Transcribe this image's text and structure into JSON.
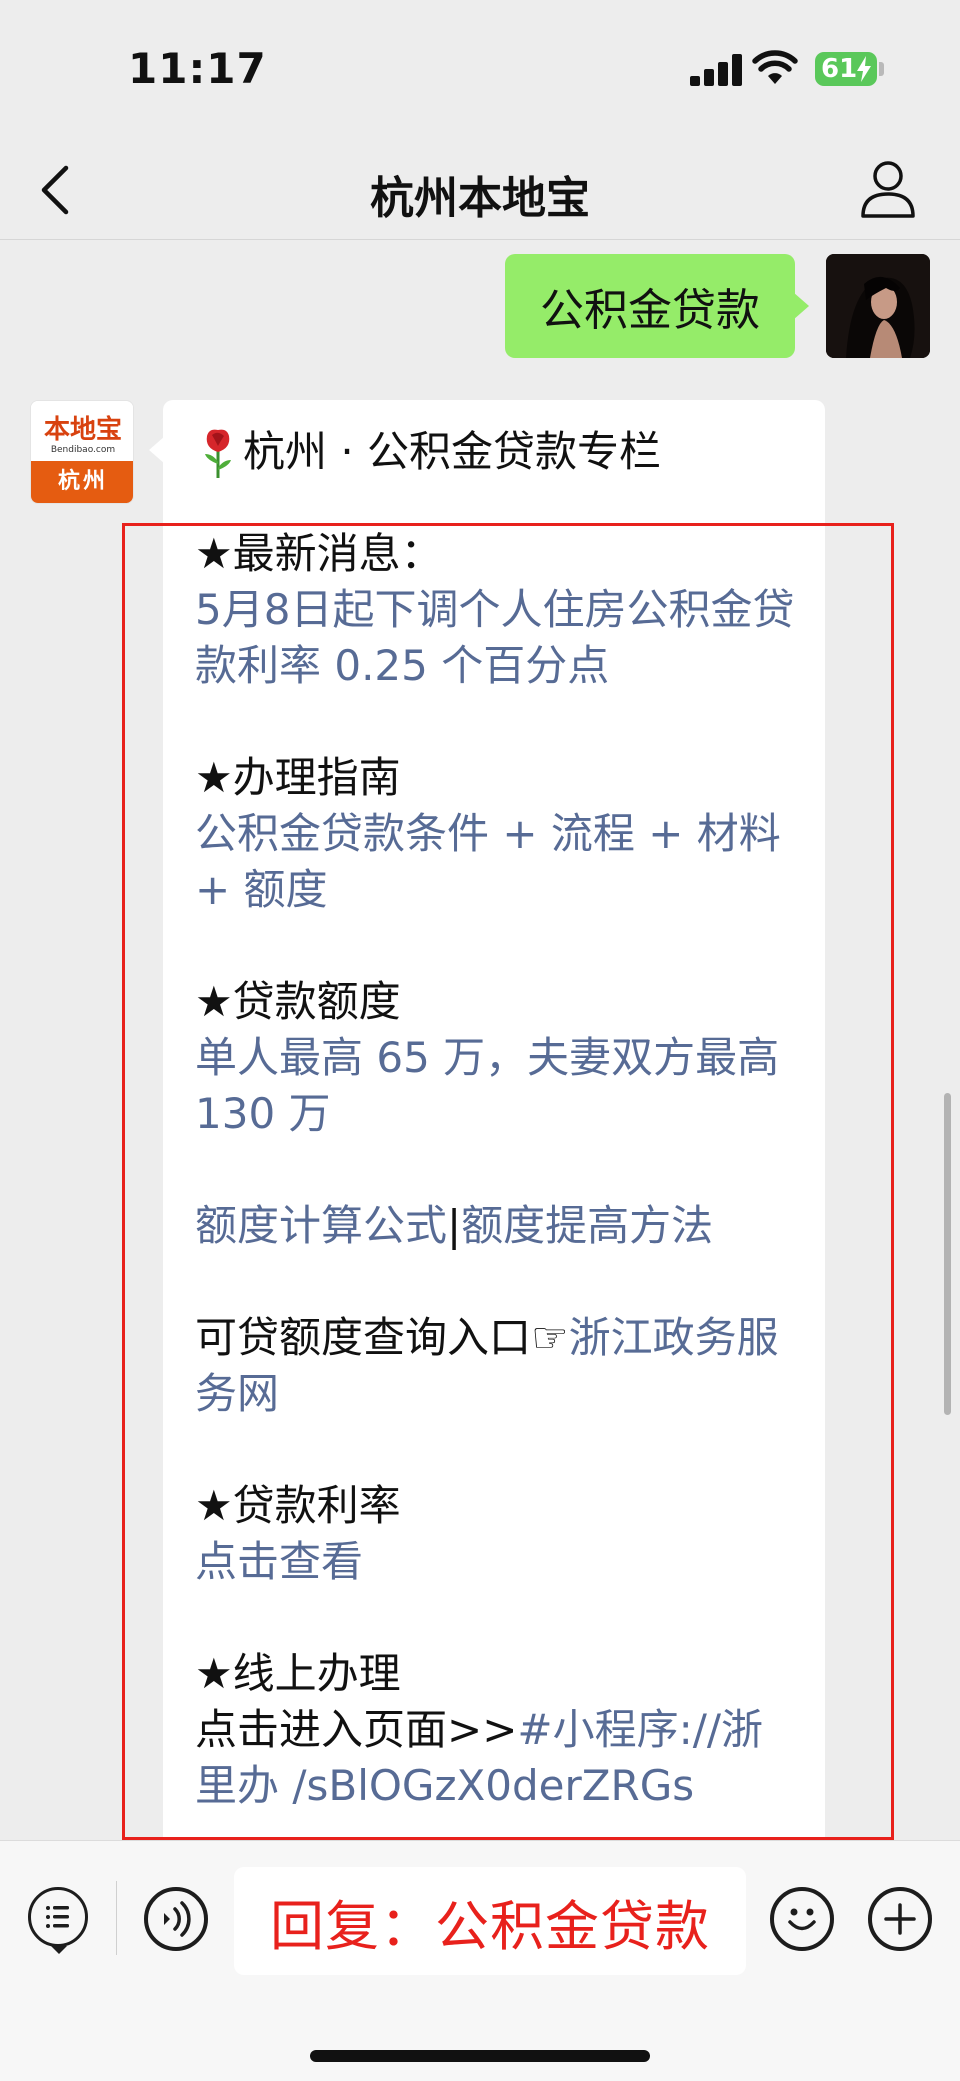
{
  "status_bar": {
    "time": "11:17",
    "battery_level": "61",
    "battery_charging": true,
    "battery_color": "#5ac85a"
  },
  "nav": {
    "title": "杭州本地宝",
    "back_icon": "chevron-left-icon",
    "profile_icon": "person-icon"
  },
  "messages": {
    "sent": {
      "text": "公积金贷款",
      "bubble_color": "#95ec69"
    },
    "received": {
      "avatar": {
        "logo_text": "本地宝",
        "logo_sub": "Bendibao.com",
        "city": "杭州"
      },
      "header": "杭州 · 公积金贷款专栏",
      "header_icon": "rose-emoji",
      "sections": {
        "news_title": "★最新消息：",
        "news_link": "5月8日起下调个人住房公积金贷款利率 0.25 个百分点",
        "guide_title": "★办理指南",
        "guide_link": "公积金贷款条件 + 流程 + 材料 + 额度",
        "amount_title": "★贷款额度",
        "amount_link": "单人最高 65 万，夫妻双方最高 130 万",
        "calc_link": "额度计算公式",
        "calc_separator": "|",
        "raise_link": "额度提高方法",
        "query_text": "可贷额度查询入口☞",
        "query_link": "浙江政务服务网",
        "rate_title": "★贷款利率",
        "rate_link": "点击查看",
        "online_title": "★线上办理",
        "online_text": "点击进入页面>>",
        "online_link": "#小程序://浙里办 /sBlOGzX0derZRGs"
      },
      "link_color": "#576b95"
    }
  },
  "input_bar": {
    "text": "回复：公积金贷款",
    "text_color": "#e8211c",
    "menu_icon": "list-menu-icon",
    "voice_icon": "voice-icon",
    "emoji_icon": "smiley-icon",
    "plus_icon": "plus-icon"
  },
  "annotation": {
    "frame_color": "#e8211c"
  }
}
